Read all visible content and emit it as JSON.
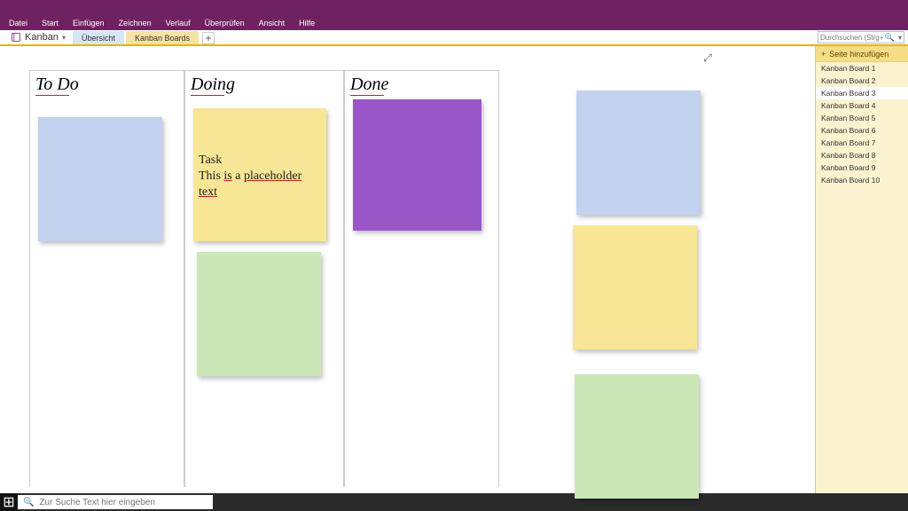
{
  "ribbon": {
    "items": [
      "Datei",
      "Start",
      "Einfügen",
      "Zeichnen",
      "Verlauf",
      "Überprüfen",
      "Ansicht",
      "Hilfe"
    ]
  },
  "notebook": {
    "name": "Kanban"
  },
  "tabs": {
    "inactive": "Übersicht",
    "active": "Kanban Boards",
    "add": "+"
  },
  "search": {
    "placeholder": "Durchsuchen (Strg+E)"
  },
  "columns": {
    "todo": "To Do",
    "doing": "Doing",
    "done": "Done"
  },
  "task_note": {
    "line1": "Task",
    "line2_pre": "This ",
    "line2_u1": "is",
    "line2_mid": " a ",
    "line2_u2": "placeholder",
    "line2_sp": " ",
    "line2_u3": "text"
  },
  "side": {
    "add_page": "Seite hinzufügen",
    "pages": [
      "Kanban Board 1",
      "Kanban Board 2",
      "Kanban Board 3",
      "Kanban Board 4",
      "Kanban Board 5",
      "Kanban Board 6",
      "Kanban Board 7",
      "Kanban Board 8",
      "Kanban Board 9",
      "Kanban Board 10"
    ],
    "selected_index": 2
  },
  "taskbar": {
    "search_placeholder": "Zur Suche Text hier eingeben"
  },
  "icons": {
    "plus": "+",
    "magnifier": "🔍",
    "fullscreen": "⤢",
    "chev_down": "▾",
    "windows": "⊞"
  }
}
